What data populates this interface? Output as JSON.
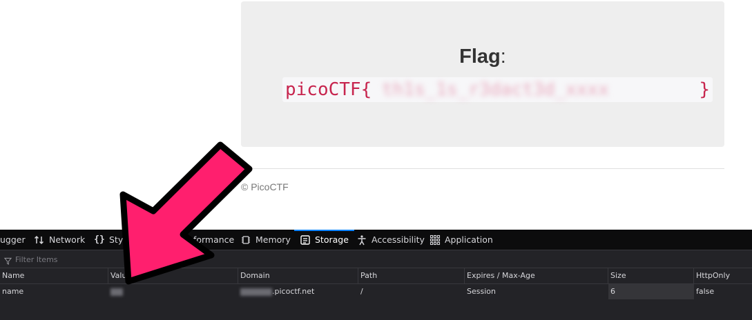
{
  "page": {
    "flag_label": "Flag",
    "flag_colon": ":",
    "flag_prefix": "picoCTF{",
    "flag_redacted": "th1s_1s_r3dact3d_xxxx",
    "flag_suffix": "}",
    "footer": "© PicoCTF"
  },
  "devtools": {
    "tabs": [
      {
        "label": "ugger",
        "icon": "debugger-icon"
      },
      {
        "label": "Network",
        "icon": "network-arrows-icon"
      },
      {
        "label": "Sty",
        "icon": "braces-icon"
      },
      {
        "label": "Performance",
        "icon": "performance-icon"
      },
      {
        "label": "Memory",
        "icon": "memory-chip-icon"
      },
      {
        "label": "Storage",
        "icon": "storage-icon",
        "active": true
      },
      {
        "label": "Accessibility",
        "icon": "accessibility-icon"
      },
      {
        "label": "Application",
        "icon": "application-grid-icon"
      }
    ],
    "filter_placeholder": "Filter Items",
    "columns": [
      "Name",
      "Valu",
      "Domain",
      "Path",
      "Expires / Max-Age",
      "Size",
      "HttpOnly"
    ],
    "rows": [
      {
        "name": "name",
        "value": "",
        "domain": ".picoctf.net",
        "path": "/",
        "expires": "Session",
        "size": "6",
        "httponly": "false"
      }
    ]
  },
  "colors": {
    "arrow_fill": "#ff1f6e",
    "accent": "#0a84ff",
    "flag_code": "#c7254e"
  }
}
